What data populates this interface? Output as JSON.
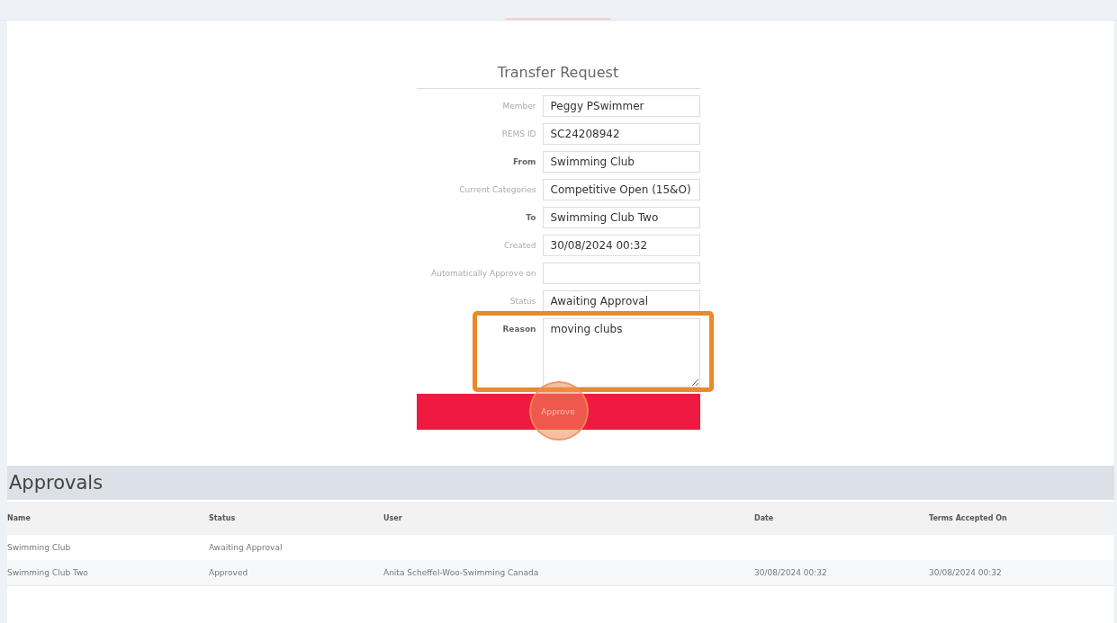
{
  "form": {
    "title": "Transfer Request",
    "fields": [
      {
        "label": "Member",
        "value": "Peggy PSwimmer",
        "kind": "input",
        "bold": false,
        "highlighted": false
      },
      {
        "label": "REMS ID",
        "value": "SC24208942",
        "kind": "input",
        "bold": false,
        "highlighted": false
      },
      {
        "label": "From",
        "value": "Swimming Club",
        "kind": "input",
        "bold": true,
        "highlighted": false
      },
      {
        "label": "Current Categories",
        "value": "Competitive Open (15&O)",
        "kind": "input",
        "bold": false,
        "highlighted": false
      },
      {
        "label": "To",
        "value": "Swimming Club Two",
        "kind": "input",
        "bold": true,
        "highlighted": false
      },
      {
        "label": "Created",
        "value": "30/08/2024 00:32",
        "kind": "input",
        "bold": false,
        "highlighted": false
      },
      {
        "label": "Automatically Approve on",
        "kind": "input",
        "bold": false,
        "highlighted": false
      },
      {
        "label": "Status",
        "value": "Awaiting Approval",
        "kind": "input",
        "bold": false,
        "highlighted": false
      },
      {
        "label": "Reason",
        "value": "moving clubs",
        "kind": "textarea",
        "bold": true,
        "highlighted": true
      }
    ],
    "button": {
      "label": "Approve",
      "clicked": true
    }
  },
  "approvals": {
    "title": "Approvals",
    "columns": [
      "Name",
      "Status",
      "User",
      "Date",
      "Terms Accepted On"
    ],
    "rows": [
      [
        "Swimming Club",
        "Awaiting Approval",
        "",
        "",
        ""
      ],
      [
        "Swimming Club Two",
        "Approved",
        "Anita Scheffel-Woo-Swimming Canada",
        "30/08/2024 00:32",
        "30/08/2024 00:32"
      ]
    ]
  }
}
